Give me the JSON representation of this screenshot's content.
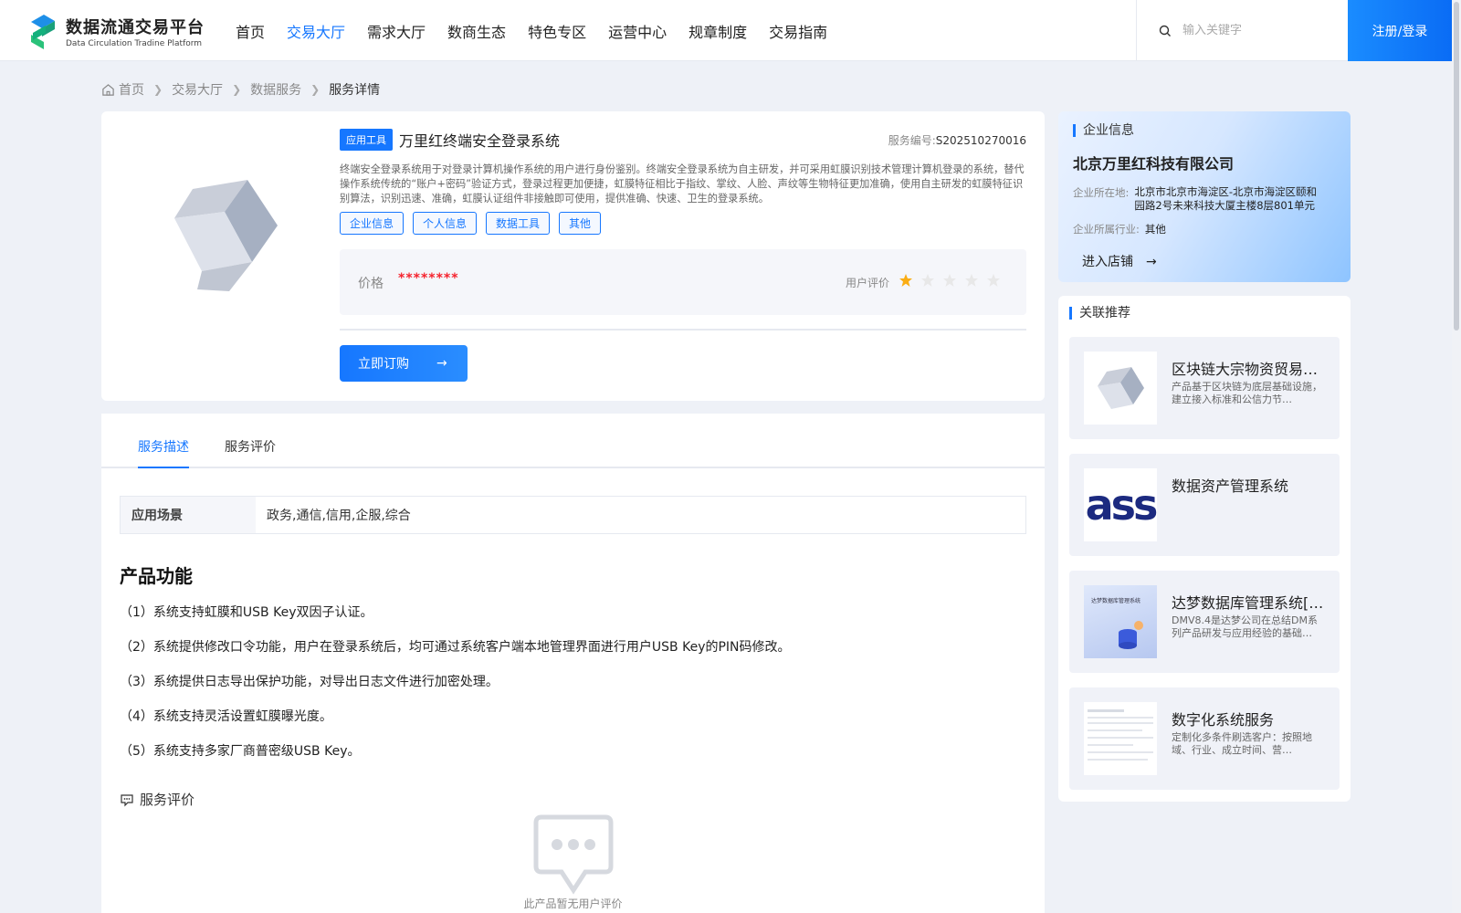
{
  "header": {
    "logo_title": "数据流通交易平台",
    "logo_subtitle": "Data Circulation Tradine Platform",
    "nav": [
      "首页",
      "交易大厅",
      "需求大厅",
      "数商生态",
      "特色专区",
      "运营中心",
      "规章制度",
      "交易指南"
    ],
    "nav_active_index": 1,
    "search_placeholder": "输入关键字",
    "login_label": "注册/登录"
  },
  "breadcrumb": [
    "首页",
    "交易大厅",
    "数据服务",
    "服务详情"
  ],
  "product": {
    "type_tag": "应用工具",
    "title": "万里红终端安全登录系统",
    "code_label": "服务编号:",
    "code": "S202510270016",
    "description": "终端安全登录系统用于对登录计算机操作系统的用户进行身份鉴别。终端安全登录系统为自主研发，并可采用虹膜识别技术管理计算机登录的系统，替代操作系统传统的“账户+密码”验证方式，登录过程更加便捷，虹膜特征相比于指纹、掌纹、人脸、声纹等生物特征更加准确，使用自主研发的虹膜特征识别算法，识别迅速、准确，虹膜认证组件非接触即可使用，提供准确、快速、卫生的登录系统。",
    "tags": [
      "企业信息",
      "个人信息",
      "数据工具",
      "其他"
    ],
    "price_label": "价格",
    "price_value": "********",
    "rating_label": "用户评价",
    "rating": 1,
    "rating_max": 5,
    "buy_label": "立即订购",
    "buy_arrow": "→"
  },
  "details": {
    "tabs": [
      "服务描述",
      "服务评价"
    ],
    "active_tab": 0,
    "scene_label": "应用场景",
    "scene_value": "政务,通信,信用,企服,综合",
    "function_title": "产品功能",
    "functions": [
      "（1）系统支持虹膜和USB Key双因子认证。",
      "（2）系统提供修改口令功能，用户在登录系统后，均可通过系统客户端本地管理界面进行用户USB Key的PIN码修改。",
      "（3）系统提供日志导出保护功能，对导出日志文件进行加密处理。",
      "（4）系统支持灵活设置虹膜曝光度。",
      "（5）系统支持多家厂商普密级USB Key。"
    ],
    "review_title": "服务评价",
    "empty_text": "此产品暂无用户评价"
  },
  "enterprise": {
    "heading": "企业信息",
    "name": "北京万里红科技有限公司",
    "location_label": "企业所在地:",
    "location": "北京市北京市海淀区-北京市海淀区颐和园路2号未来科技大厦主楼8层801单元",
    "industry_label": "企业所属行业:",
    "industry": "其他",
    "enter_label": "进入店铺",
    "enter_arrow": "→"
  },
  "recommend": {
    "heading": "关联推荐",
    "items": [
      {
        "title": "区块链大宗物资贸易…",
        "desc": "产品基于区块链为底层基础设施，建立接入标准和公信力节…",
        "thumb": "logo"
      },
      {
        "title": "数据资产管理系统",
        "desc": "",
        "thumb": "ass",
        "thumb_text": "ass"
      },
      {
        "title": "达梦数据库管理系统[…",
        "desc": "DMV8.4是达梦公司在总结DM系列产品研发与应用经验的基础…",
        "thumb": "dameng",
        "thumb_text": "达梦数据库管理系统"
      },
      {
        "title": "数字化系统服务",
        "desc": "定制化多条件刷选客户：按照地域、行业、成立时间、营…",
        "thumb": "doc"
      }
    ]
  },
  "colors": {
    "primary": "#1677ff",
    "price": "#f5222d",
    "star_active": "#faad14",
    "star_inactive": "#e8e8e8"
  }
}
